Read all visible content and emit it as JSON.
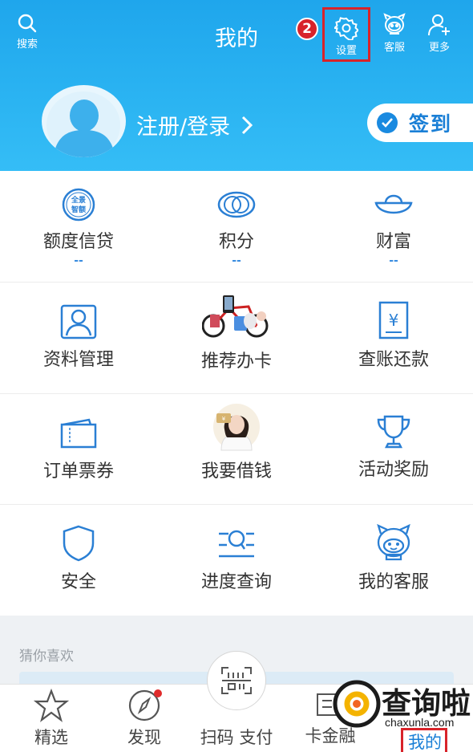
{
  "header": {
    "title": "我的",
    "search_label": "搜索",
    "settings_label": "设置",
    "service_label": "客服",
    "more_label": "更多",
    "step_badge": "2",
    "login_text": "注册/登录",
    "checkin_label": "签到"
  },
  "grid": {
    "row1": [
      {
        "label": "额度信贷",
        "sub": "--",
        "icon": "quota-badge-icon",
        "icon_text": "全景\n智额"
      },
      {
        "label": "积分",
        "sub": "--",
        "icon": "points-rings-icon"
      },
      {
        "label": "财富",
        "sub": "--",
        "icon": "ingot-icon"
      }
    ],
    "row2": [
      {
        "label": "资料管理",
        "icon": "profile-icon"
      },
      {
        "label": "推荐办卡",
        "icon": "gift-bike-image"
      },
      {
        "label": "查账还款",
        "icon": "bill-yuan-icon"
      }
    ],
    "row3": [
      {
        "label": "订单票券",
        "icon": "ticket-icon"
      },
      {
        "label": "我要借钱",
        "icon": "woman-portrait-image"
      },
      {
        "label": "活动奖励",
        "icon": "trophy-icon"
      }
    ],
    "row4": [
      {
        "label": "安全",
        "icon": "shield-icon"
      },
      {
        "label": "进度查询",
        "icon": "progress-search-icon"
      },
      {
        "label": "我的客服",
        "icon": "service-robot-icon"
      }
    ]
  },
  "recommend": {
    "title": "猜你喜欢"
  },
  "tabbar": {
    "tabs": [
      {
        "label": "精选",
        "icon": "star-icon"
      },
      {
        "label": "发现",
        "icon": "compass-icon"
      },
      {
        "label": "扫码 支付",
        "icon": "scan-pay-icon"
      },
      {
        "label": "卡金融",
        "icon": "card-icon"
      },
      {
        "label": "我的",
        "icon": "mine-icon"
      }
    ]
  },
  "watermark": {
    "text": "查询啦",
    "url": "chaxunla.com"
  },
  "colors": {
    "header_blue": "#1fa6ec",
    "icon_blue": "#2a7fd4",
    "highlight_red": "#d8232a"
  }
}
